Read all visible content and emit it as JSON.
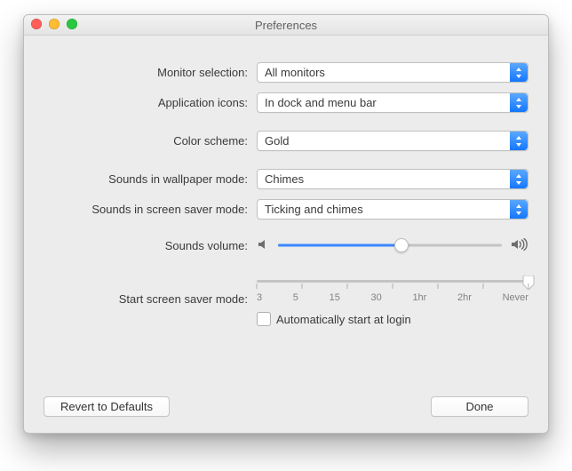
{
  "window": {
    "title": "Preferences"
  },
  "form": {
    "monitor_label": "Monitor selection:",
    "monitor_value": "All monitors",
    "appicons_label": "Application icons:",
    "appicons_value": "In dock and menu bar",
    "color_label": "Color scheme:",
    "color_value": "Gold",
    "sounds_wallpaper_label": "Sounds in wallpaper mode:",
    "sounds_wallpaper_value": "Chimes",
    "sounds_ss_label": "Sounds in screen saver mode:",
    "sounds_ss_value": "Ticking and chimes",
    "volume_label": "Sounds volume:",
    "volume_percent": 55,
    "start_ss_label": "Start screen saver mode:",
    "start_ss_ticks": [
      "3",
      "5",
      "15",
      "30",
      "1hr",
      "2hr",
      "Never"
    ],
    "start_ss_selected_index": 6,
    "autostart_label": "Automatically start at login",
    "autostart_checked": false
  },
  "buttons": {
    "revert": "Revert to Defaults",
    "done": "Done"
  }
}
